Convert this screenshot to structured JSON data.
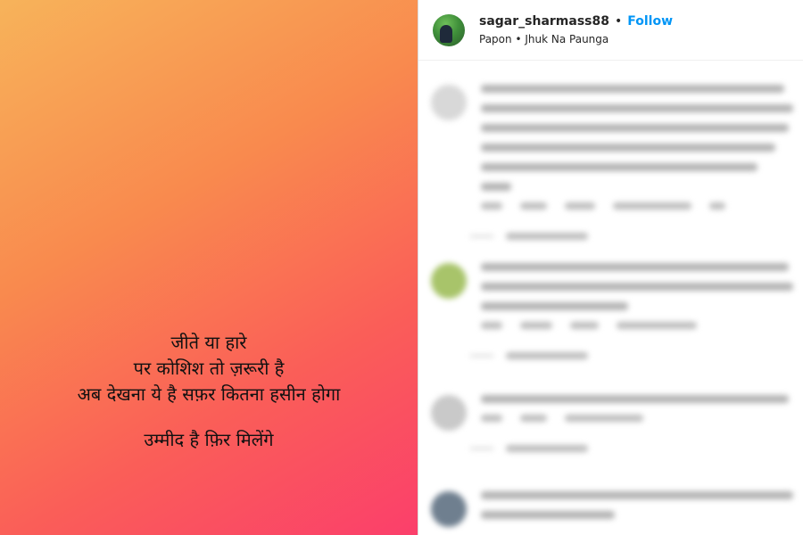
{
  "post": {
    "line1": "जीते या हारे",
    "line2": "पर कोशिश तो ज़रूरी है",
    "line3": "अब देखना ये है सफ़र कितना हसीन होगा",
    "line4": "उम्मीद है फ़िर मिलेंगे"
  },
  "header": {
    "username": "sagar_sharmass88",
    "separator": "•",
    "follow_label": "Follow",
    "audio_artist": "Papon",
    "audio_bullet": "•",
    "audio_title": "Jhuk Na Paunga"
  },
  "comments": [
    {
      "avatar_color": "#d8d8d8"
    },
    {
      "avatar_color": "#a8c46a"
    },
    {
      "avatar_color": "#c9c9c9"
    },
    {
      "avatar_color": "#6f7f8f"
    }
  ]
}
